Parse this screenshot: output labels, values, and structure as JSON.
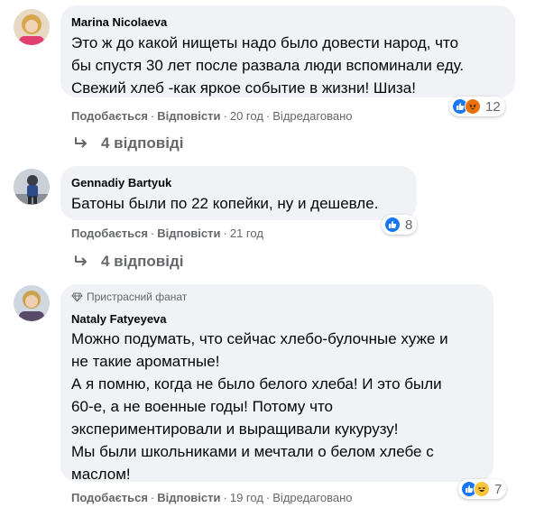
{
  "comments": [
    {
      "author": "Marina Nicolaeva",
      "lines": [
        "Это ж до какой нищеты надо было довести народ, что",
        "бы спустя 30 лет после развала люди вспоминали еду.",
        "Свежий хлеб -как яркое событие в жизни! Шиза!"
      ],
      "like_label": "Подобається",
      "reply_label": "Відповісти",
      "time": "20 год",
      "edited": "Відредаговано",
      "reaction_count": "12",
      "reactions": [
        "like",
        "angry"
      ],
      "replies_label": "4 відповіді"
    },
    {
      "author": "Gennadiy Bartyuk",
      "lines": [
        "Батоны были по 22 копейки, ну и дешевле."
      ],
      "like_label": "Подобається",
      "reply_label": "Відповісти",
      "time": "21 год",
      "reaction_count": "8",
      "reactions": [
        "like"
      ],
      "replies_label": "4 відповіді"
    },
    {
      "badge": "Пристрасний фанат",
      "author": "Nataly Fatyeyeva",
      "lines": [
        "Можно подумать, что сейчас хлебо-булочные хуже и",
        "не такие ароматные!",
        "А я помню, когда не было белого хлеба! И это были",
        "60-е, а не военные годы! Потому что",
        "экспериментировали и выращивали кукурузу!",
        "Мы были школьниками и мечтали о белом хлебе с",
        "маслом!"
      ],
      "like_label": "Подобається",
      "reply_label": "Відповісти",
      "time": "19 год",
      "edited": "Відредаговано",
      "reaction_count": "7",
      "reactions": [
        "like",
        "haha"
      ]
    }
  ],
  "colors": {
    "bubble": "#f0f2f5",
    "like_blue": "#1877f2",
    "meta_gray": "#65676b"
  }
}
